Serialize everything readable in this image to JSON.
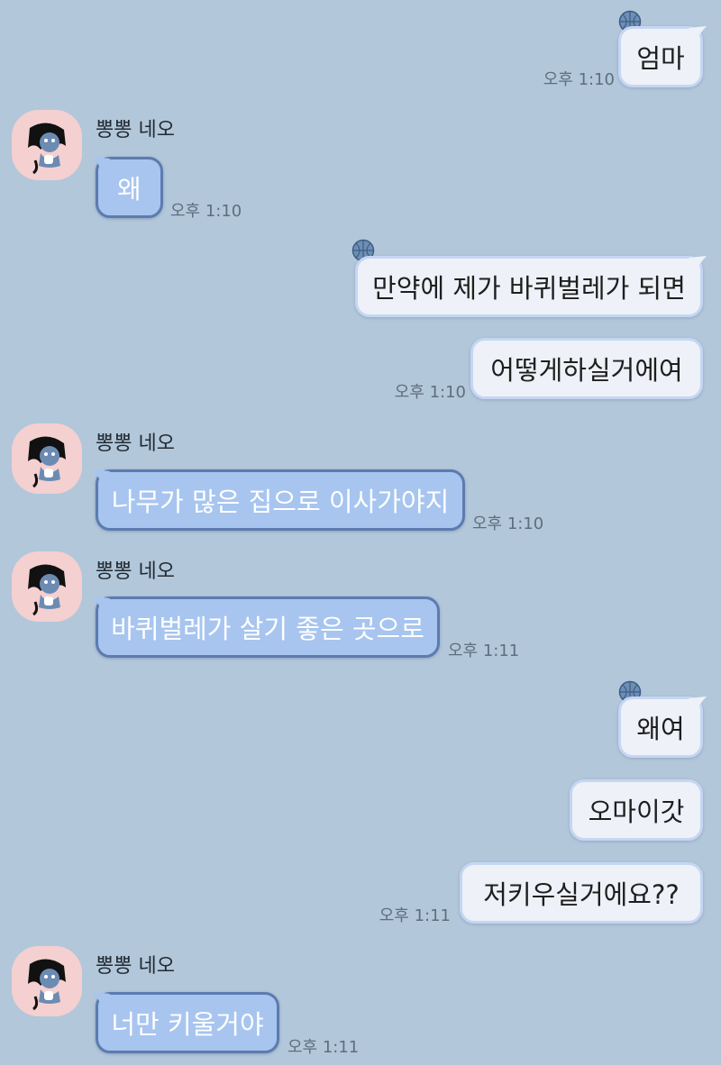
{
  "contact": {
    "name": "뽕뽕 네오",
    "avatar_icon": "neo-character-icon",
    "avatar_bg": "#f4d0d0"
  },
  "colors": {
    "background": "#b2c7da",
    "my_bubble": "#eef1f7",
    "their_bubble": "#a7c5ef"
  },
  "messages": [
    {
      "from": "me",
      "text": "엄마",
      "time": "오후 1:10"
    },
    {
      "from": "them",
      "text": "왜",
      "time": "오후 1:10"
    },
    {
      "from": "me",
      "text": "만약에 제가 바퀴벌레가 되면"
    },
    {
      "from": "me",
      "text": "어떻게하실거에여",
      "time": "오후 1:10"
    },
    {
      "from": "them",
      "text": "나무가 많은 집으로 이사가야지",
      "time": "오후 1:10"
    },
    {
      "from": "them",
      "text": "바퀴벌레가 살기 좋은 곳으로",
      "time": "오후 1:11"
    },
    {
      "from": "me",
      "text": "왜여"
    },
    {
      "from": "me",
      "text": "오마이갓"
    },
    {
      "from": "me",
      "text": "저키우실거에요??",
      "time": "오후 1:11"
    },
    {
      "from": "them",
      "text": "너만 키울거야",
      "time": "오후 1:11"
    }
  ]
}
